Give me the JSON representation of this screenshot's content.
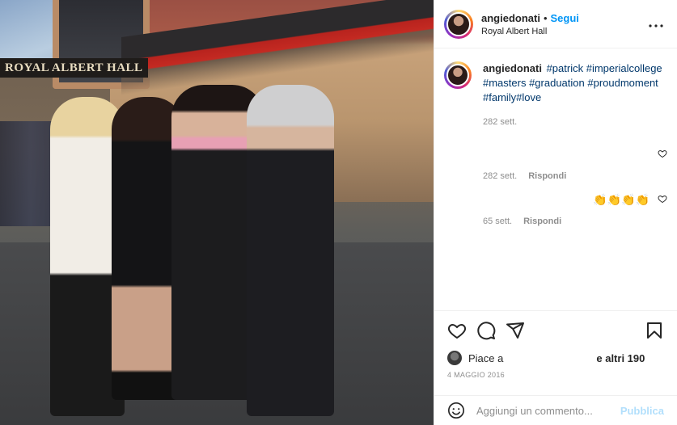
{
  "post": {
    "username": "angiedonati",
    "follow_label": "Segui",
    "separator": "•",
    "location": "Royal Albert Hall",
    "more_icon": "ellipsis-icon"
  },
  "photo": {
    "sign_text": "ROYAL ALBERT HALL"
  },
  "caption": {
    "username": "angiedonati",
    "hashtags": "#patrick #imperialcollege #masters #graduation #proudmoment #family#love",
    "time": "282 sett."
  },
  "comments": [
    {
      "text": "",
      "time": "282 sett.",
      "reply_label": "Rispondi"
    },
    {
      "text": "👏👏👏👏",
      "time": "65 sett.",
      "reply_label": "Rispondi"
    }
  ],
  "actions": {
    "like_icon": "heart-icon",
    "comment_icon": "comment-bubble-icon",
    "share_icon": "paper-plane-icon",
    "save_icon": "bookmark-icon"
  },
  "likes": {
    "prefix": "Piace a",
    "suffix": "e altri 190"
  },
  "date": "4 MAGGIO 2016",
  "add_comment": {
    "placeholder": "Aggiungi un commento...",
    "publish_label": "Pubblica",
    "emoji_icon": "smiley-icon"
  },
  "colors": {
    "link_blue": "#0095f6",
    "hashtag": "#00376b",
    "muted": "#8e8e8e",
    "publish_disabled": "#b2dffc"
  }
}
